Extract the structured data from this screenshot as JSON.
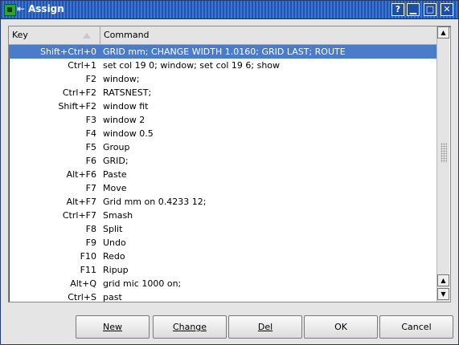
{
  "window": {
    "title": "Assign",
    "help_glyph": "?",
    "min_glyph": "▁",
    "max_glyph": "□",
    "close_glyph": "✕"
  },
  "table": {
    "columns": {
      "key": "Key",
      "command": "Command"
    },
    "rows": [
      {
        "key": "Shift+Ctrl+0",
        "command": "GRID mm; CHANGE WIDTH 1.0160; GRID LAST; ROUTE",
        "selected": true
      },
      {
        "key": "Ctrl+1",
        "command": "set col 19 0; window; set col 19 6; show"
      },
      {
        "key": "F2",
        "command": "window;"
      },
      {
        "key": "Ctrl+F2",
        "command": "RATSNEST;"
      },
      {
        "key": "Shift+F2",
        "command": "window fit"
      },
      {
        "key": "F3",
        "command": "window 2"
      },
      {
        "key": "F4",
        "command": "window 0.5"
      },
      {
        "key": "F5",
        "command": "Group"
      },
      {
        "key": "F6",
        "command": "GRID;"
      },
      {
        "key": "Alt+F6",
        "command": "Paste"
      },
      {
        "key": "F7",
        "command": "Move"
      },
      {
        "key": "Alt+F7",
        "command": "Grid mm on 0.4233 12;"
      },
      {
        "key": "Ctrl+F7",
        "command": "Smash"
      },
      {
        "key": "F8",
        "command": "Split"
      },
      {
        "key": "F9",
        "command": "Undo"
      },
      {
        "key": "F10",
        "command": "Redo"
      },
      {
        "key": "F11",
        "command": "Ripup"
      },
      {
        "key": "Alt+Q",
        "command": "grid mic 1000 on;"
      },
      {
        "key": "Ctrl+S",
        "command": "past"
      }
    ]
  },
  "buttons": {
    "new": "New",
    "change": "Change",
    "del": "Del",
    "ok": "OK",
    "cancel": "Cancel"
  },
  "colors": {
    "titlebar": "#1d55b4",
    "selection": "#4a7cc9",
    "dialog_bg": "#e5e5e5"
  }
}
